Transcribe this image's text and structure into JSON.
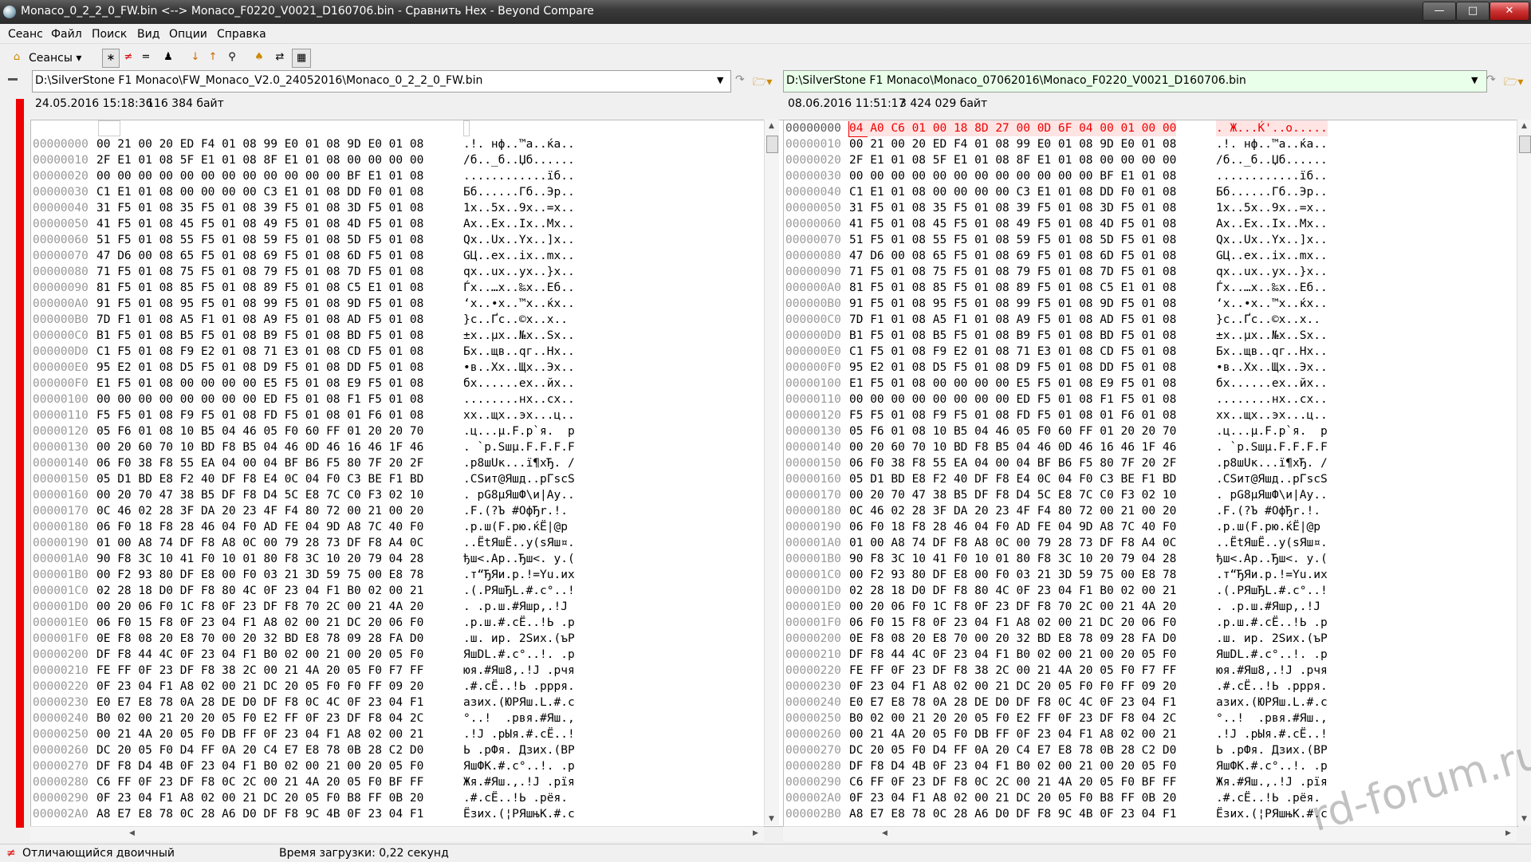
{
  "window": {
    "title": "Monaco_0_2_2_0_FW.bin <--> Monaco_F0220_V0021_D160706.bin - Сравнить Hex - Beyond Compare"
  },
  "menu": [
    "Сеанс",
    "Файл",
    "Поиск",
    "Вид",
    "Опции",
    "Справка"
  ],
  "toolbar": {
    "sessions_label": "Сеансы"
  },
  "left": {
    "path": "D:\\SilverStone F1 Monaco\\FW_Monaco_V2.0_24052016\\Monaco_0_2_2_0_FW.bin",
    "date": "24.05.2016 15:18:36",
    "size": "116 384 байт",
    "rows": [
      [
        "00000000",
        "00 21 00 20 ED F4 01 08 99 E0 01 08 9D E0 01 08",
        ".!. нф..™а..ќа.."
      ],
      [
        "00000010",
        "2F E1 01 08 5F E1 01 08 8F E1 01 08 00 00 00 00",
        "/б.._б..Џб......"
      ],
      [
        "00000020",
        "00 00 00 00 00 00 00 00 00 00 00 00 BF E1 01 08",
        "............їб.."
      ],
      [
        "00000030",
        "C1 E1 01 08 00 00 00 00 C3 E1 01 08 DD F0 01 08",
        "Бб......Гб..Эр.."
      ],
      [
        "00000040",
        "31 F5 01 08 35 F5 01 08 39 F5 01 08 3D F5 01 08",
        "1х..5х..9х..=х.."
      ],
      [
        "00000050",
        "41 F5 01 08 45 F5 01 08 49 F5 01 08 4D F5 01 08",
        "Ax..Ex..Ix..Mx.."
      ],
      [
        "00000060",
        "51 F5 01 08 55 F5 01 08 59 F5 01 08 5D F5 01 08",
        "Qx..Ux..Yx..]x.."
      ],
      [
        "00000070",
        "47 D6 00 08 65 F5 01 08 69 F5 01 08 6D F5 01 08",
        "GЦ..ex..ix..mx.."
      ],
      [
        "00000080",
        "71 F5 01 08 75 F5 01 08 79 F5 01 08 7D F5 01 08",
        "qx..ux..yx..}x.."
      ],
      [
        "00000090",
        "81 F5 01 08 85 F5 01 08 89 F5 01 08 C5 E1 01 08",
        "Ѓх..…х..‰х..Еб.."
      ],
      [
        "000000A0",
        "91 F5 01 08 95 F5 01 08 99 F5 01 08 9D F5 01 08",
        "‘х..•х..™х..ќх.."
      ],
      [
        "000000B0",
        "7D F1 01 08 A5 F1 01 08 A9 F5 01 08 AD F5 01 08",
        "}с..Ґс..©х..­х.."
      ],
      [
        "000000C0",
        "B1 F5 01 08 B5 F5 01 08 B9 F5 01 08 BD F5 01 08",
        "±х..µх..№х..Ѕх.."
      ],
      [
        "000000D0",
        "C1 F5 01 08 F9 E2 01 08 71 E3 01 08 CD F5 01 08",
        "Бх..щв..qг..Нх.."
      ],
      [
        "000000E0",
        "95 E2 01 08 D5 F5 01 08 D9 F5 01 08 DD F5 01 08",
        "•в..Хх..Щх..Эх.."
      ],
      [
        "000000F0",
        "E1 F5 01 08 00 00 00 00 E5 F5 01 08 E9 F5 01 08",
        "бх......ех..йх.."
      ],
      [
        "00000100",
        "00 00 00 00 00 00 00 00 ED F5 01 08 F1 F5 01 08",
        "........нх..сх.."
      ],
      [
        "00000110",
        "F5 F5 01 08 F9 F5 01 08 FD F5 01 08 01 F6 01 08",
        "хх..щх..эх...ц.."
      ],
      [
        "00000120",
        "05 F6 01 08 10 B5 04 46 05 F0 60 FF 01 20 20 70",
        ".ц...µ.F.р`я.  p"
      ],
      [
        "00000130",
        "00 20 60 70 10 BD F8 B5 04 46 0D 46 16 46 1F 46",
        ". `p.Ѕшµ.F.F.F.F"
      ],
      [
        "00000140",
        "06 F0 38 F8 55 EA 04 00 04 BF B6 F5 80 7F 20 2F",
        ".р8шUк...ї¶хЂ. /"
      ],
      [
        "00000150",
        "05 D1 BD E8 F2 40 DF F8 E4 0C 04 F0 C3 BE F1 BD",
        ".СЅит@Яшд..рГѕсЅ"
      ],
      [
        "00000160",
        "00 20 70 47 38 B5 DF F8 D4 5C E8 7C C0 F3 02 10",
        ". pG8µЯшФ\\и|Ау.."
      ],
      [
        "00000170",
        "0C 46 02 28 3F DA 20 23 4F F4 80 72 00 21 00 20",
        ".F.(?Ъ #OфЂr.!. "
      ],
      [
        "00000180",
        "06 F0 18 F8 28 46 04 F0 AD FE 04 9D A8 7C 40 F0",
        ".р.ш(F.р­ю.ќЁ|@р"
      ],
      [
        "00000190",
        "01 00 A8 74 DF F8 A8 0C 00 79 28 73 DF F8 A4 0C",
        "..ЁtЯшЁ..y(sЯш¤."
      ],
      [
        "000001A0",
        "90 F8 3C 10 41 F0 10 01 80 F8 3C 10 20 79 04 28",
        "ђш<.Ар..Ђш<. y.("
      ],
      [
        "000001B0",
        "00 F2 93 80 DF E8 00 F0 03 21 3D 59 75 00 E8 78",
        ".т“ЂЯи.р.!=Yu.иx"
      ],
      [
        "000001C0",
        "02 28 18 D0 DF F8 80 4C 0F 23 04 F1 B0 02 00 21",
        ".(.РЯшЂL.#.с°..!"
      ],
      [
        "000001D0",
        "00 20 06 F0 1C F8 0F 23 DF F8 70 2C 00 21 4A 20",
        ". .р.ш.#Яшp,.!J "
      ],
      [
        "000001E0",
        "06 F0 15 F8 0F 23 04 F1 A8 02 00 21 DC 20 06 F0",
        ".р.ш.#.сЁ..!Ь .р"
      ],
      [
        "000001F0",
        "0E F8 08 20 E8 70 00 20 32 BD E8 78 09 28 FA D0",
        ".ш. иp. 2Ѕиx.(ъР"
      ],
      [
        "00000200",
        "DF F8 44 4C 0F 23 04 F1 B0 02 00 21 00 20 05 F0",
        "ЯшDL.#.с°..!. .р"
      ],
      [
        "00000210",
        "FE FF 0F 23 DF F8 38 2C 00 21 4A 20 05 F0 F7 FF",
        "юя.#Яш8,.!J .рчя"
      ],
      [
        "00000220",
        "0F 23 04 F1 A8 02 00 21 DC 20 05 F0 F0 FF 09 20",
        ".#.сЁ..!Ь .ррря. "
      ],
      [
        "00000230",
        "E0 E7 E8 78 0A 28 DE D0 DF F8 0C 4C 0F 23 04 F1",
        "азих.(ЮРЯш.L.#.с"
      ],
      [
        "00000240",
        "B0 02 00 21 20 20 05 F0 E2 FF 0F 23 DF F8 04 2C",
        "°..!  .рвя.#Яш.,"
      ],
      [
        "00000250",
        "00 21 4A 20 05 F0 DB FF 0F 23 04 F1 A8 02 00 21",
        ".!J .рЫя.#.сЁ..!"
      ],
      [
        "00000260",
        "DC 20 05 F0 D4 FF 0A 20 C4 E7 E8 78 0B 28 C2 D0",
        "Ь .рФя. Дзих.(ВР"
      ],
      [
        "00000270",
        "DF F8 D4 4B 0F 23 04 F1 B0 02 00 21 00 20 05 F0",
        "ЯшФK.#.с°..!. .р"
      ],
      [
        "00000280",
        "C6 FF 0F 23 DF F8 0C 2C 00 21 4A 20 05 F0 BF FF",
        "Жя.#Яш.,.!J .рїя"
      ],
      [
        "00000290",
        "0F 23 04 F1 A8 02 00 21 DC 20 05 F0 B8 FF 0B 20",
        ".#.сЁ..!Ь .рёя. "
      ],
      [
        "000002A0",
        "A8 E7 E8 78 0C 28 A6 D0 DF F8 9C 4B 0F 23 04 F1",
        "Ёзих.(¦РЯшњK.#.с"
      ]
    ]
  },
  "right": {
    "path": "D:\\SilverStone F1 Monaco\\Monaco_07062016\\Monaco_F0220_V0021_D160706.bin",
    "date": "08.06.2016 11:51:17",
    "size": "3 424 029 байт",
    "rows": [
      [
        "00000000",
        "04 A0 C6 01 00 18 8D 27 00 0D 6F 04 00 01 00 00",
        ". Ж...Ќ'..o....."
      ],
      [
        "00000010",
        "00 21 00 20 ED F4 01 08 99 E0 01 08 9D E0 01 08",
        ".!. нф..™а..ќа.."
      ],
      [
        "00000020",
        "2F E1 01 08 5F E1 01 08 8F E1 01 08 00 00 00 00",
        "/б.._б..Џб......"
      ],
      [
        "00000030",
        "00 00 00 00 00 00 00 00 00 00 00 00 BF E1 01 08",
        "............їб.."
      ],
      [
        "00000040",
        "C1 E1 01 08 00 00 00 00 C3 E1 01 08 DD F0 01 08",
        "Бб......Гб..Эр.."
      ],
      [
        "00000050",
        "31 F5 01 08 35 F5 01 08 39 F5 01 08 3D F5 01 08",
        "1х..5х..9х..=х.."
      ],
      [
        "00000060",
        "41 F5 01 08 45 F5 01 08 49 F5 01 08 4D F5 01 08",
        "Ax..Ex..Ix..Mx.."
      ],
      [
        "00000070",
        "51 F5 01 08 55 F5 01 08 59 F5 01 08 5D F5 01 08",
        "Qx..Ux..Yx..]x.."
      ],
      [
        "00000080",
        "47 D6 00 08 65 F5 01 08 69 F5 01 08 6D F5 01 08",
        "GЦ..ex..ix..mx.."
      ],
      [
        "00000090",
        "71 F5 01 08 75 F5 01 08 79 F5 01 08 7D F5 01 08",
        "qx..ux..yx..}x.."
      ],
      [
        "000000A0",
        "81 F5 01 08 85 F5 01 08 89 F5 01 08 C5 E1 01 08",
        "Ѓх..…х..‰х..Еб.."
      ],
      [
        "000000B0",
        "91 F5 01 08 95 F5 01 08 99 F5 01 08 9D F5 01 08",
        "‘х..•х..™х..ќх.."
      ],
      [
        "000000C0",
        "7D F1 01 08 A5 F1 01 08 A9 F5 01 08 AD F5 01 08",
        "}с..Ґс..©х..­х.."
      ],
      [
        "000000D0",
        "B1 F5 01 08 B5 F5 01 08 B9 F5 01 08 BD F5 01 08",
        "±х..µх..№х..Ѕх.."
      ],
      [
        "000000E0",
        "C1 F5 01 08 F9 E2 01 08 71 E3 01 08 CD F5 01 08",
        "Бх..щв..qг..Нх.."
      ],
      [
        "000000F0",
        "95 E2 01 08 D5 F5 01 08 D9 F5 01 08 DD F5 01 08",
        "•в..Хх..Щх..Эх.."
      ],
      [
        "00000100",
        "E1 F5 01 08 00 00 00 00 E5 F5 01 08 E9 F5 01 08",
        "бх......ех..йх.."
      ],
      [
        "00000110",
        "00 00 00 00 00 00 00 00 ED F5 01 08 F1 F5 01 08",
        "........нх..сх.."
      ],
      [
        "00000120",
        "F5 F5 01 08 F9 F5 01 08 FD F5 01 08 01 F6 01 08",
        "хх..щх..эх...ц.."
      ],
      [
        "00000130",
        "05 F6 01 08 10 B5 04 46 05 F0 60 FF 01 20 20 70",
        ".ц...µ.F.р`я.  p"
      ],
      [
        "00000140",
        "00 20 60 70 10 BD F8 B5 04 46 0D 46 16 46 1F 46",
        ". `p.Ѕшµ.F.F.F.F"
      ],
      [
        "00000150",
        "06 F0 38 F8 55 EA 04 00 04 BF B6 F5 80 7F 20 2F",
        ".р8шUк...ї¶хЂ. /"
      ],
      [
        "00000160",
        "05 D1 BD E8 F2 40 DF F8 E4 0C 04 F0 C3 BE F1 BD",
        ".СЅит@Яшд..рГѕсЅ"
      ],
      [
        "00000170",
        "00 20 70 47 38 B5 DF F8 D4 5C E8 7C C0 F3 02 10",
        ". pG8µЯшФ\\и|Ау.."
      ],
      [
        "00000180",
        "0C 46 02 28 3F DA 20 23 4F F4 80 72 00 21 00 20",
        ".F.(?Ъ #OфЂr.!. "
      ],
      [
        "00000190",
        "06 F0 18 F8 28 46 04 F0 AD FE 04 9D A8 7C 40 F0",
        ".р.ш(F.р­ю.ќЁ|@р"
      ],
      [
        "000001A0",
        "01 00 A8 74 DF F8 A8 0C 00 79 28 73 DF F8 A4 0C",
        "..ЁtЯшЁ..y(sЯш¤."
      ],
      [
        "000001B0",
        "90 F8 3C 10 41 F0 10 01 80 F8 3C 10 20 79 04 28",
        "ђш<.Ар..Ђш<. y.("
      ],
      [
        "000001C0",
        "00 F2 93 80 DF E8 00 F0 03 21 3D 59 75 00 E8 78",
        ".т“ЂЯи.р.!=Yu.иx"
      ],
      [
        "000001D0",
        "02 28 18 D0 DF F8 80 4C 0F 23 04 F1 B0 02 00 21",
        ".(.РЯшЂL.#.с°..!"
      ],
      [
        "000001E0",
        "00 20 06 F0 1C F8 0F 23 DF F8 70 2C 00 21 4A 20",
        ". .р.ш.#Яшp,.!J "
      ],
      [
        "000001F0",
        "06 F0 15 F8 0F 23 04 F1 A8 02 00 21 DC 20 06 F0",
        ".р.ш.#.сЁ..!Ь .р"
      ],
      [
        "00000200",
        "0E F8 08 20 E8 70 00 20 32 BD E8 78 09 28 FA D0",
        ".ш. иp. 2Ѕиx.(ъР"
      ],
      [
        "00000210",
        "DF F8 44 4C 0F 23 04 F1 B0 02 00 21 00 20 05 F0",
        "ЯшDL.#.с°..!. .р"
      ],
      [
        "00000220",
        "FE FF 0F 23 DF F8 38 2C 00 21 4A 20 05 F0 F7 FF",
        "юя.#Яш8,.!J .рчя"
      ],
      [
        "00000230",
        "0F 23 04 F1 A8 02 00 21 DC 20 05 F0 F0 FF 09 20",
        ".#.сЁ..!Ь .ррря. "
      ],
      [
        "00000240",
        "E0 E7 E8 78 0A 28 DE D0 DF F8 0C 4C 0F 23 04 F1",
        "азих.(ЮРЯш.L.#.с"
      ],
      [
        "00000250",
        "B0 02 00 21 20 20 05 F0 E2 FF 0F 23 DF F8 04 2C",
        "°..!  .рвя.#Яш.,"
      ],
      [
        "00000260",
        "00 21 4A 20 05 F0 DB FF 0F 23 04 F1 A8 02 00 21",
        ".!J .рЫя.#.сЁ..!"
      ],
      [
        "00000270",
        "DC 20 05 F0 D4 FF 0A 20 C4 E7 E8 78 0B 28 C2 D0",
        "Ь .рФя. Дзих.(ВР"
      ],
      [
        "00000280",
        "DF F8 D4 4B 0F 23 04 F1 B0 02 00 21 00 20 05 F0",
        "ЯшФK.#.с°..!. .р"
      ],
      [
        "00000290",
        "C6 FF 0F 23 DF F8 0C 2C 00 21 4A 20 05 F0 BF FF",
        "Жя.#Яш.,.!J .рїя"
      ],
      [
        "000002A0",
        "0F 23 04 F1 A8 02 00 21 DC 20 05 F0 B8 FF 0B 20",
        ".#.сЁ..!Ь .рёя. "
      ],
      [
        "000002B0",
        "A8 E7 E8 78 0C 28 A6 D0 DF F8 9C 4B 0F 23 04 F1",
        "Ёзих.(¦РЯшњK.#.с"
      ]
    ]
  },
  "status": {
    "compare_type": "Отличающийся двоичный",
    "load_time": "Время загрузки: 0,22 секунд"
  },
  "watermark": "rd-forum.ru",
  "colors": {
    "diff": "#e00000",
    "diff_bg": "#ffe4e4",
    "right_path_bg": "#e9ffe9"
  }
}
